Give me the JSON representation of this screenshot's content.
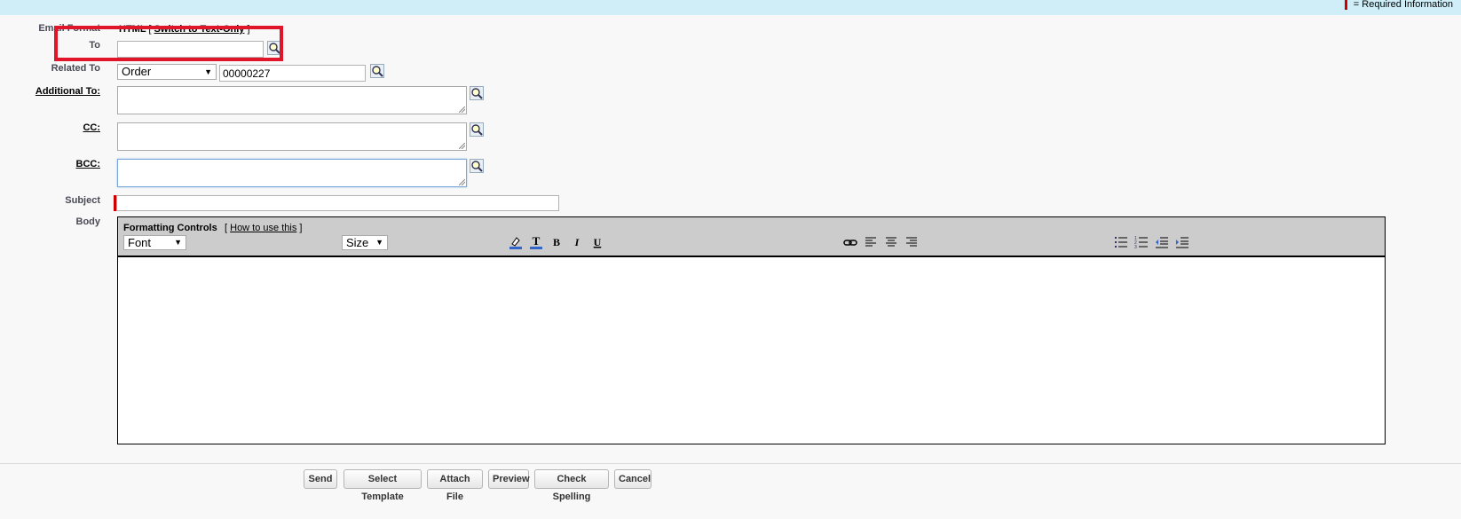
{
  "legend": {
    "required_info": "= Required Information",
    "required_color": "#cc0000"
  },
  "email_format": {
    "label": "Email Format",
    "value": "HTML",
    "switch_link": "Switch to Text-Only"
  },
  "to": {
    "label": "To",
    "value": ""
  },
  "related_to": {
    "label": "Related To",
    "type_selected": "Order",
    "record_value": "00000227"
  },
  "additional_to": {
    "label": "Additional To:"
  },
  "cc": {
    "label": "CC:"
  },
  "bcc": {
    "label": "BCC:"
  },
  "subject": {
    "label": "Subject",
    "value": ""
  },
  "body": {
    "label": "Body",
    "toolbar": {
      "title": "Formatting Controls",
      "help_prefix": "[",
      "help_link": "How to use this",
      "help_suffix": "]",
      "font_selected": "Font",
      "size_selected": "Size"
    }
  },
  "icons": {
    "lookup": "magnifier-lookup-icon",
    "toolbar": [
      "highlight-color-icon",
      "text-color-icon",
      "bold-icon",
      "italic-icon",
      "underline-icon",
      "link-icon",
      "align-left-icon",
      "align-center-icon",
      "align-right-icon",
      "bulleted-list-icon",
      "numbered-list-icon",
      "outdent-icon",
      "indent-icon"
    ]
  },
  "buttons": {
    "send": "Send",
    "select_template": "Select Template",
    "attach_file": "Attach File",
    "preview": "Preview",
    "check_spelling": "Check Spelling",
    "cancel": "Cancel"
  },
  "colors": {
    "header_bg": "#cfeef8",
    "highlight_border": "#e0152a"
  }
}
